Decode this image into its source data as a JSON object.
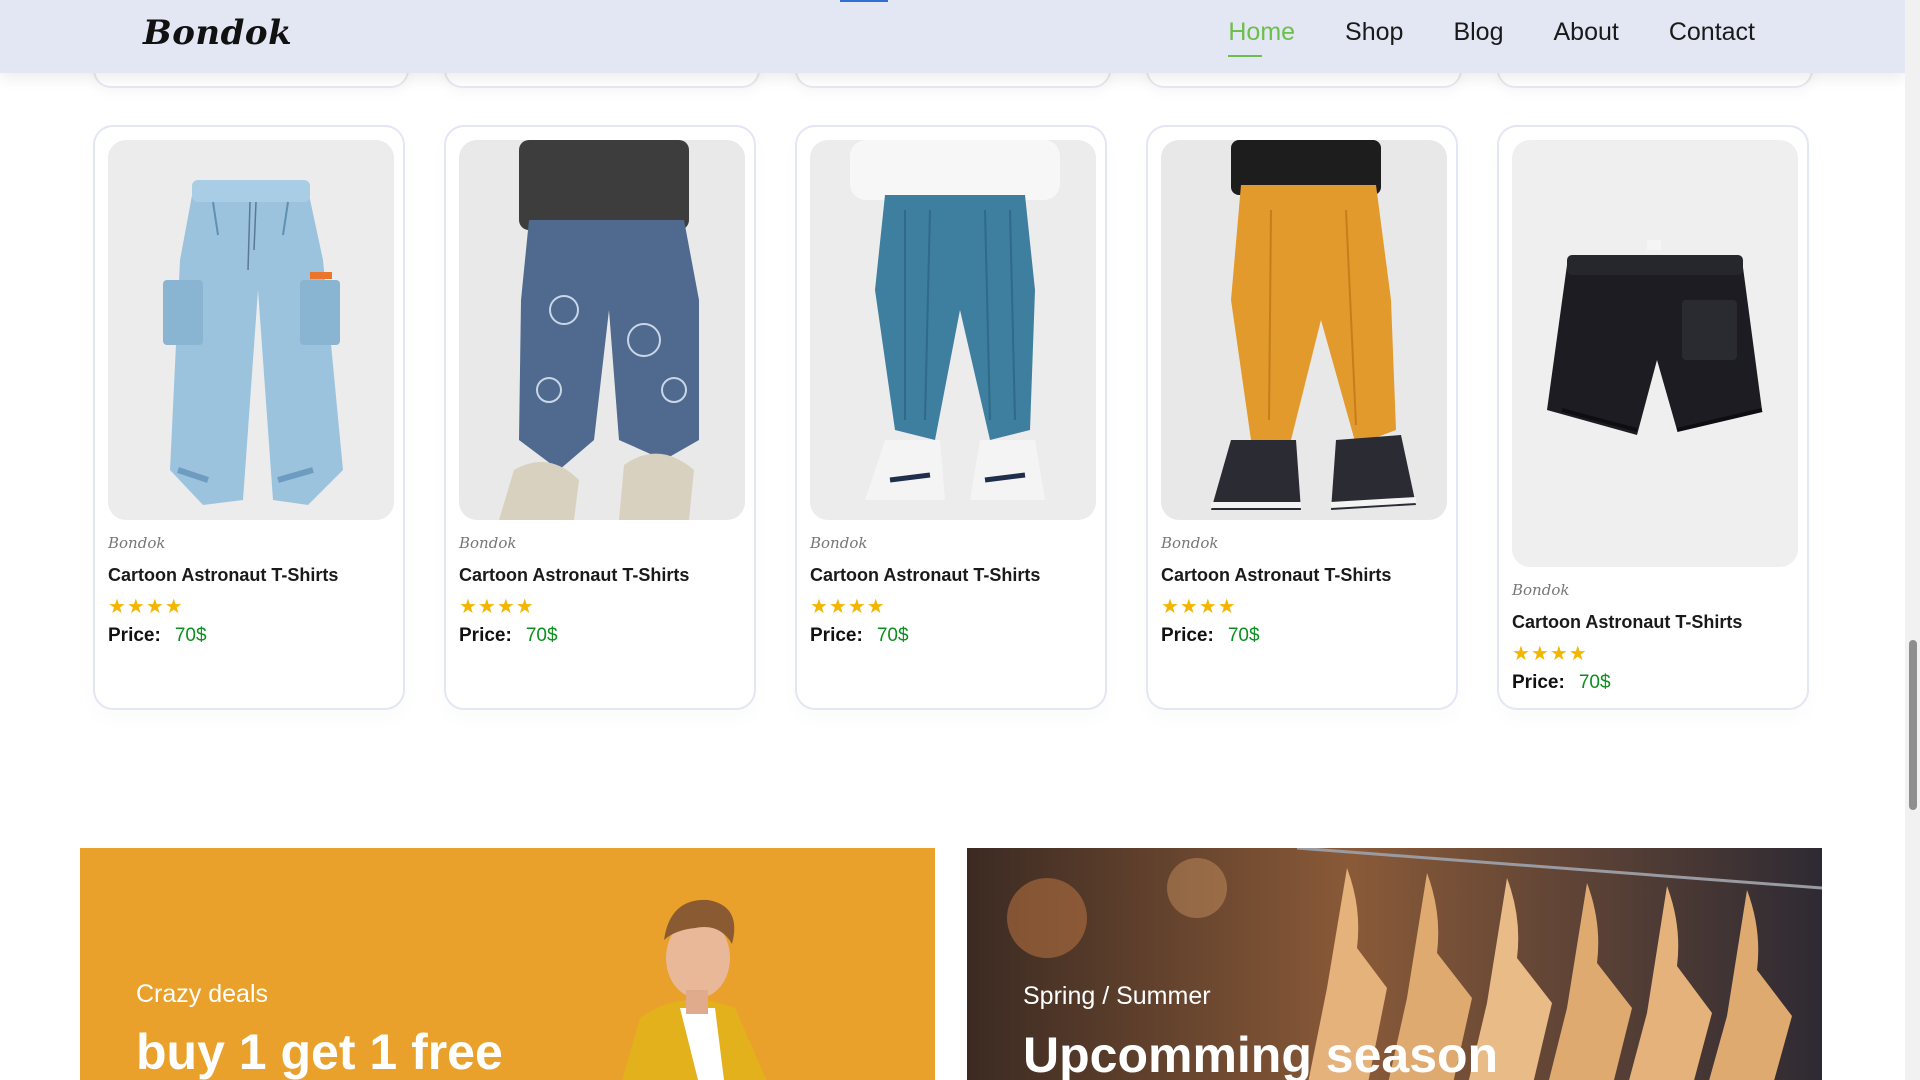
{
  "header": {
    "logo": "Bondok",
    "nav": [
      {
        "label": "Home",
        "active": true
      },
      {
        "label": "Shop",
        "active": false
      },
      {
        "label": "Blog",
        "active": false
      },
      {
        "label": "About",
        "active": false
      },
      {
        "label": "Contact",
        "active": false
      }
    ]
  },
  "products": [
    {
      "brand": "Bondok",
      "name": "Cartoon Astronaut T-Shirts",
      "rating": 4,
      "stars": "★★★★",
      "price_label": "Price:",
      "price": "70$",
      "image": "light-denim-cargo-jogger"
    },
    {
      "brand": "Bondok",
      "name": "Cartoon Astronaut T-Shirts",
      "rating": 4,
      "stars": "★★★★",
      "price_label": "Price:",
      "price": "70$",
      "image": "printed-denim-jogger"
    },
    {
      "brand": "Bondok",
      "name": "Cartoon Astronaut T-Shirts",
      "rating": 4,
      "stars": "★★★★",
      "price_label": "Price:",
      "price": "70$",
      "image": "blue-corduroy-jogger"
    },
    {
      "brand": "Bondok",
      "name": "Cartoon Astronaut T-Shirts",
      "rating": 4,
      "stars": "★★★★",
      "price_label": "Price:",
      "price": "70$",
      "image": "orange-corduroy-pants"
    },
    {
      "brand": "Bondok",
      "name": "Cartoon Astronaut T-Shirts",
      "rating": 4,
      "stars": "★★★★",
      "price_label": "Price:",
      "price": "70$",
      "image": "black-cargo-shorts"
    }
  ],
  "banners": [
    {
      "subtitle": "Crazy deals",
      "title": "buy 1 get 1 free",
      "image": "man-yellow-blazer"
    },
    {
      "subtitle": "Spring / Summer",
      "title": "Upcomming season",
      "image": "clothes-on-hangers"
    }
  ],
  "colors": {
    "header_bg": "#e3e6f3",
    "active_nav": "#6cbf4a",
    "star": "#f3b600",
    "price": "#0b8f1e",
    "deals_banner": "#e9a12b"
  }
}
